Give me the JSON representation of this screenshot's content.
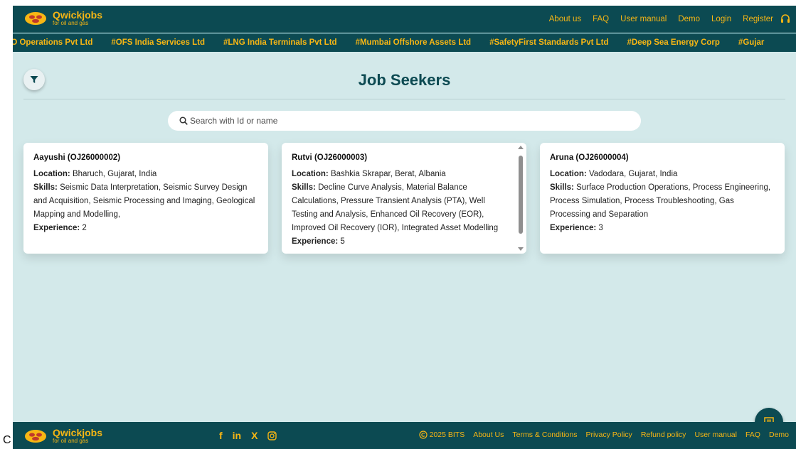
{
  "brand": {
    "name": "Qwickjobs",
    "tagline": "for oil and gas"
  },
  "colors": {
    "primary": "#0c4a52",
    "accent": "#f7b614",
    "background": "#d3e9ea"
  },
  "nav": {
    "items": [
      "About us",
      "FAQ",
      "User manual",
      "Demo",
      "Login",
      "Register"
    ],
    "support_icon": "headset-icon"
  },
  "ticker": {
    "items": [
      "PSO Operations Pvt Ltd",
      "#OFS India Services Ltd",
      "#LNG India Terminals Pvt Ltd",
      "#Mumbai Offshore Assets Ltd",
      "#SafetyFirst Standards Pvt Ltd",
      "#Deep Sea Energy Corp",
      "#Gujar"
    ]
  },
  "page": {
    "title": "Job Seekers",
    "filter_icon": "filter-icon",
    "search_placeholder": "Search with Id or name"
  },
  "labels": {
    "location": "Location:",
    "skills": "Skills:",
    "experience": "Experience:"
  },
  "seekers": [
    {
      "name": "Aayushi (OJ26000002)",
      "location": "Bharuch, Gujarat, India",
      "skills": "Seismic Data Interpretation, Seismic Survey Design and Acquisition, Seismic Processing and Imaging, Geological Mapping and Modelling,",
      "experience": "2"
    },
    {
      "name": "Rutvi (OJ26000003)",
      "location": "Bashkia Skrapar, Berat, Albania",
      "skills": "Decline Curve Analysis, Material Balance Calculations, Pressure Transient Analysis (PTA), Well Testing and Analysis, Enhanced Oil Recovery (EOR), Improved Oil Recovery (IOR), Integrated Asset Modelling",
      "experience": "5"
    },
    {
      "name": "Aruna (OJ26000004)",
      "location": "Vadodara, Gujarat, India",
      "skills": "Surface Production Operations, Process Engineering, Process Simulation, Process Troubleshooting, Gas Processing and Separation",
      "experience": "3"
    }
  ],
  "footer": {
    "social": [
      "f",
      "in",
      "X"
    ],
    "copyright": "2025 BITS",
    "links": [
      "About Us",
      "Terms & Conditions",
      "Privacy Policy",
      "Refund policy",
      "User manual",
      "FAQ",
      "Demo"
    ]
  },
  "stray_text": "C"
}
